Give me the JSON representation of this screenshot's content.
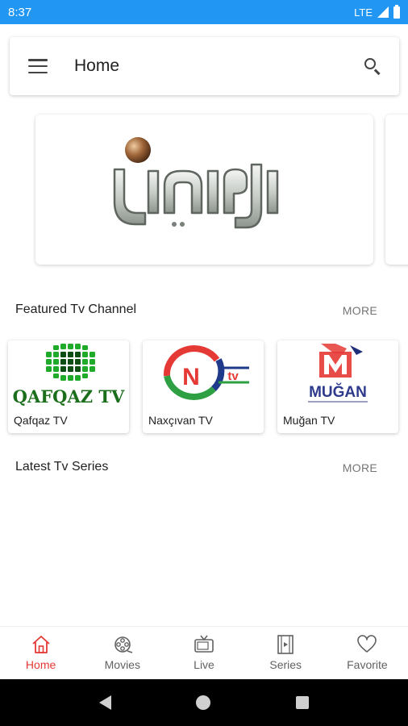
{
  "status_bar": {
    "time": "8:37",
    "network": "LTE"
  },
  "app_bar": {
    "title": "Home"
  },
  "featured": {
    "title": "Featured Tv Channel",
    "more": "MORE"
  },
  "channels": [
    {
      "name": "Qafqaz TV",
      "logo_text": "QAFQAZ TV"
    },
    {
      "name": "Naxçıvan TV",
      "logo_text": "N",
      "logo_suffix": "tv"
    },
    {
      "name": "Muğan TV",
      "logo_text": "MUĞAN"
    }
  ],
  "series": {
    "title": "Latest Tv Series",
    "more": "MORE"
  },
  "bottom_nav": {
    "items": [
      {
        "label": "Home",
        "icon": "home-icon",
        "active": true
      },
      {
        "label": "Movies",
        "icon": "film-reel-icon"
      },
      {
        "label": "Live",
        "icon": "tv-icon"
      },
      {
        "label": "Series",
        "icon": "film-strip-icon"
      },
      {
        "label": "Favorite",
        "icon": "heart-icon"
      }
    ]
  },
  "colors": {
    "status_bar": "#2196f3",
    "active_nav": "#e53935",
    "qafqaz_green": "#1b7a1b",
    "naxcivan_red": "#e53935",
    "mugan_blue": "#2e3a8c"
  }
}
